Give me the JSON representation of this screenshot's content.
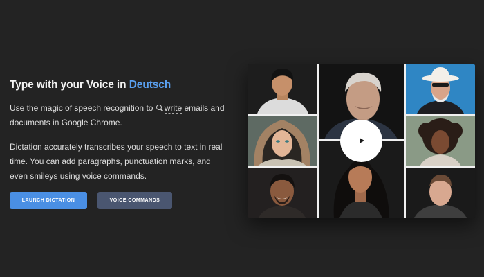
{
  "hero": {
    "headline_prefix": "Type with your Voice in ",
    "headline_language": "Deutsch",
    "p1_before": "Use the magic of speech recognition to ",
    "p1_highlight": "write",
    "p1_after": " emails and documents in Google Chrome.",
    "p2": "Dictation accurately transcribes your speech to text in real time. You can add paragraphs, punctuation marks, and even smileys using voice commands."
  },
  "buttons": {
    "launch_label": "LAUNCH DICTATION",
    "voice_label": "VOICE COMMANDS"
  },
  "colors": {
    "background": "#232323",
    "accent": "#4a8fe4",
    "language_link": "#5aa0f0",
    "secondary_button": "#4a5670"
  },
  "icons": {
    "inline": "magnifier-icon",
    "video": "play-icon"
  }
}
